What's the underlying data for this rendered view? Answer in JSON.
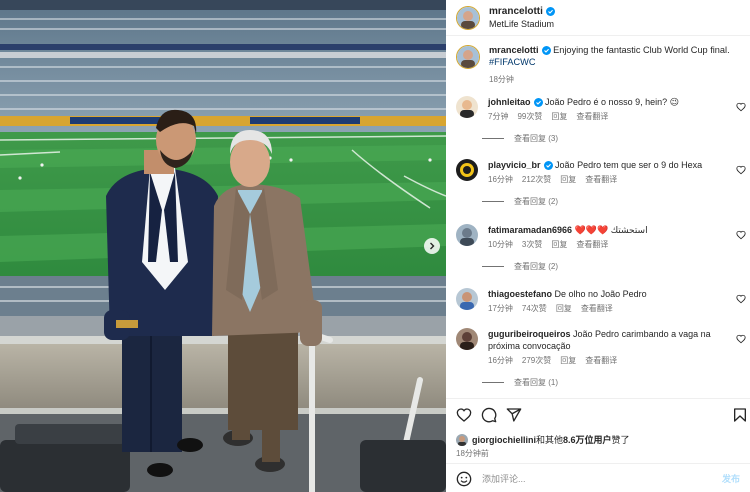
{
  "post": {
    "username": "mrancelotti",
    "location": "MetLife Stadium",
    "caption_text": "Enjoying the fantastic Club World Cup final.",
    "hashtag": "#FIFACWC",
    "time_ago": "18分钟"
  },
  "comments": [
    {
      "username": "johnleitao",
      "verified": true,
      "text": "João Pedro é o nosso 9, hein? 😉",
      "time": "7分钟",
      "likes": "99次赞",
      "reply": "回复",
      "translate": "查看翻译",
      "view_replies": "查看回复 (3)",
      "avatar_color": "#e8b98f"
    },
    {
      "username": "playvicio_br",
      "verified": true,
      "text": "João Pedro tem que ser o 9 do Hexa",
      "time": "16分钟",
      "likes": "212次赞",
      "reply": "回复",
      "translate": "查看翻译",
      "view_replies": "查看回复 (2)",
      "avatar_color": "#1d1d1d"
    },
    {
      "username": "fatimaramadan6966",
      "verified": false,
      "text": "❤️❤️❤️ استحشتك",
      "time": "10分钟",
      "likes": "3次赞",
      "reply": "回复",
      "translate": "查看翻译",
      "view_replies": "查看回复 (2)",
      "avatar_color": "#6c7b8b"
    },
    {
      "username": "thiagoestefano",
      "verified": false,
      "text": "De olho no João Pedro",
      "time": "17分钟",
      "likes": "74次赞",
      "reply": "回复",
      "translate": "查看翻译",
      "view_replies": "",
      "avatar_color": "#8d6e63"
    },
    {
      "username": "guguribeiroqueiros",
      "verified": false,
      "text": "João Pedro carimbando a vaga na próxima convocação",
      "time": "16分钟",
      "likes": "279次赞",
      "reply": "回复",
      "translate": "查看翻译",
      "view_replies": "查看回复 (1)",
      "avatar_color": "#5d4037"
    }
  ],
  "likes_line": {
    "user": "giorgiochiellini",
    "middle": "和其他",
    "count": "8.6万位用户",
    "suffix": "赞了"
  },
  "post_time": "18分钟前",
  "composer": {
    "placeholder": "添加评论...",
    "post_label": "发布"
  },
  "icons": {
    "like": "heart-icon",
    "comment": "comment-icon",
    "share": "share-icon",
    "save": "bookmark-icon",
    "emoji": "emoji-icon",
    "verified": "verified-badge-icon",
    "next": "chevron-right-icon"
  },
  "colors": {
    "verified": "#0095f6",
    "hashtag": "#00376b",
    "muted": "#737373",
    "post_button_disabled": "#b2dffc"
  }
}
